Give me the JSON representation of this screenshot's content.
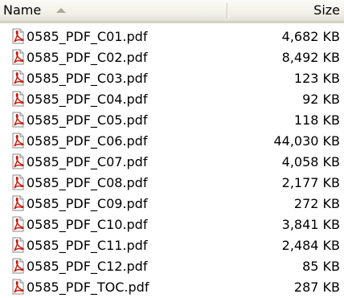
{
  "header": {
    "name_label": "Name",
    "size_label": "Size",
    "sort_direction": "ascending"
  },
  "files": [
    {
      "name": "0585_PDF_C01.pdf",
      "size": "4,682 KB",
      "icon": "pdf-file-icon"
    },
    {
      "name": "0585_PDF_C02.pdf",
      "size": "8,492 KB",
      "icon": "pdf-file-icon"
    },
    {
      "name": "0585_PDF_C03.pdf",
      "size": "123 KB",
      "icon": "pdf-file-icon"
    },
    {
      "name": "0585_PDF_C04.pdf",
      "size": "92 KB",
      "icon": "pdf-file-icon"
    },
    {
      "name": "0585_PDF_C05.pdf",
      "size": "118 KB",
      "icon": "pdf-file-icon"
    },
    {
      "name": "0585_PDF_C06.pdf",
      "size": "44,030 KB",
      "icon": "pdf-file-icon"
    },
    {
      "name": "0585_PDF_C07.pdf",
      "size": "4,058 KB",
      "icon": "pdf-file-icon"
    },
    {
      "name": "0585_PDF_C08.pdf",
      "size": "2,177 KB",
      "icon": "pdf-file-icon"
    },
    {
      "name": "0585_PDF_C09.pdf",
      "size": "272 KB",
      "icon": "pdf-file-icon"
    },
    {
      "name": "0585_PDF_C10.pdf",
      "size": "3,841 KB",
      "icon": "pdf-file-icon"
    },
    {
      "name": "0585_PDF_C11.pdf",
      "size": "2,484 KB",
      "icon": "pdf-file-icon"
    },
    {
      "name": "0585_PDF_C12.pdf",
      "size": "85 KB",
      "icon": "pdf-file-icon"
    },
    {
      "name": "0585_PDF_TOC.pdf",
      "size": "287 KB",
      "icon": "pdf-file-icon"
    }
  ],
  "colors": {
    "header_background": "#f0efe6",
    "header_bottom_border": "#d6d2c2",
    "pdf_icon_red": "#cc1100"
  }
}
